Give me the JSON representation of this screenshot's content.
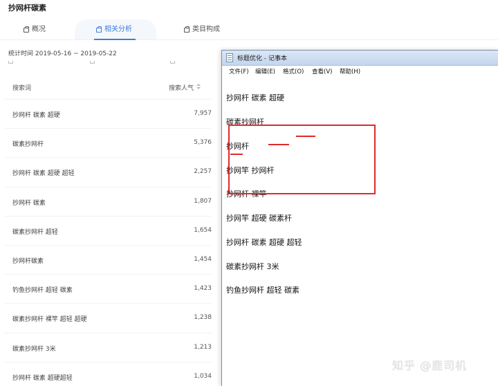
{
  "page": {
    "title": "抄网杆碳素"
  },
  "tabs": [
    {
      "label": "概况"
    },
    {
      "label": "相关分析"
    },
    {
      "label": "类目构成"
    }
  ],
  "stat_time": "统计时间 2019-05-16 ~ 2019-05-22",
  "table": {
    "headers": {
      "keyword": "搜索词",
      "popularity": "搜索人气"
    },
    "rows": [
      {
        "keyword": "抄网杆 碳素 超硬",
        "popularity": "7,957"
      },
      {
        "keyword": "碳素抄网杆",
        "popularity": "5,376"
      },
      {
        "keyword": "抄网杆 碳素 超硬 超轻",
        "popularity": "2,257"
      },
      {
        "keyword": "抄网杆 碳素",
        "popularity": "1,807"
      },
      {
        "keyword": "碳素抄网杆 超轻",
        "popularity": "1,654"
      },
      {
        "keyword": "抄网杆碳素",
        "popularity": "1,454"
      },
      {
        "keyword": "钓鱼抄网杆 超轻 碳素",
        "popularity": "1,423"
      },
      {
        "keyword": "碳素抄网杆 裸竿 超轻 超硬",
        "popularity": "1,238"
      },
      {
        "keyword": "碳素抄网杆 3米",
        "popularity": "1,213"
      },
      {
        "keyword": "抄网杆 碳素 超硬超轻",
        "popularity": "1,034"
      }
    ]
  },
  "notepad": {
    "title": "标题优化 - 记事本",
    "menu": [
      "文件(F)",
      "编辑(E)",
      "格式(O)",
      "查看(V)",
      "帮助(H)"
    ],
    "lines": [
      "抄网杆 碳素 超硬",
      "碳素抄网杆",
      "抄网杆",
      "抄网竿 抄网杆",
      "抄网杆 裸竿",
      "抄网竿 超硬 碳素杆",
      "抄网杆 碳素 超硬 超轻",
      "碳素抄网杆 3米",
      "钓鱼抄网杆 超轻 碳素"
    ]
  },
  "watermark": "知乎 @鹿司机",
  "colors": {
    "accent": "#3b7ddd",
    "highlight": "#e0292b"
  }
}
